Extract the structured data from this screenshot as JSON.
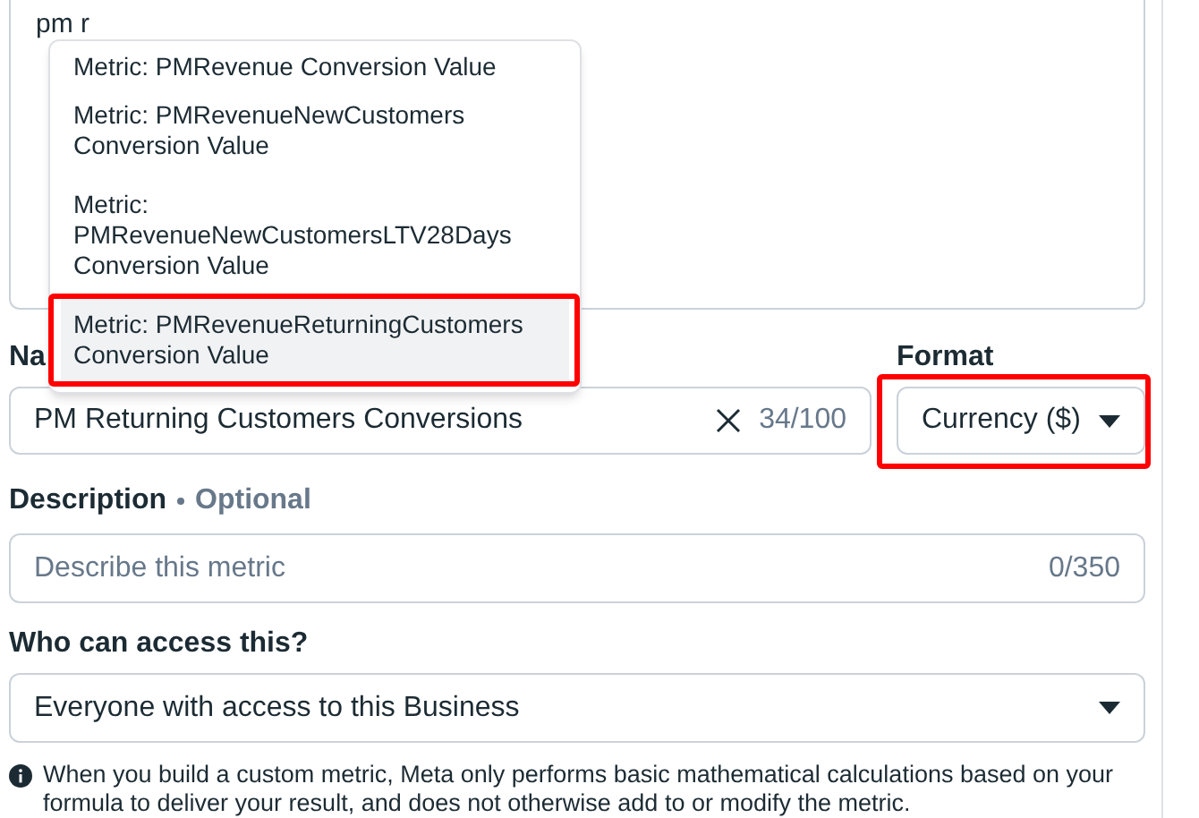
{
  "formula": {
    "value": "pm r"
  },
  "suggestions": [
    {
      "label": "Metric: PMRevenue Conversion Value",
      "selected": false
    },
    {
      "label": "Metric: PMRevenueNewCustomers Conversion Value",
      "selected": false
    },
    {
      "label": "Metric: PMRevenueNewCustomersLTV28Days Conversion Value",
      "selected": false
    },
    {
      "label": "Metric: PMRevenueReturningCustomers Conversion Value",
      "selected": true
    }
  ],
  "name": {
    "label": "Na",
    "value": "PM Returning Customers Conversions",
    "counter": "34/100"
  },
  "format": {
    "label": "Format",
    "value": "Currency ($)",
    "highlighted": true
  },
  "description": {
    "label": "Description",
    "optional": "Optional",
    "placeholder": "Describe this metric",
    "counter": "0/350"
  },
  "access": {
    "label": "Who can access this?",
    "value": "Everyone with access to this Business"
  },
  "notice": "When you build a custom metric, Meta only performs basic mathematical calculations based on your formula to deliver your result, and does not otherwise add to or modify the metric."
}
